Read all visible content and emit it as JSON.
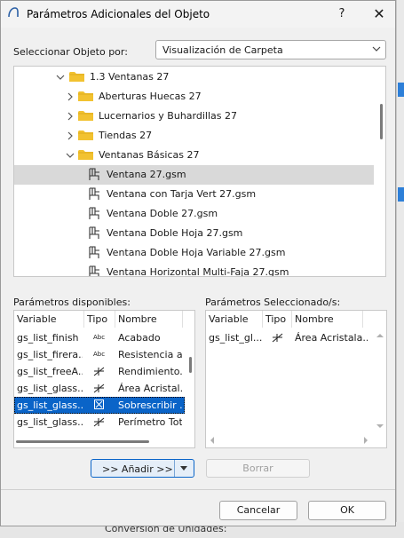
{
  "dialog": {
    "title": "Parámetros Adicionales del Objeto",
    "help_label": "?",
    "close_label": "✕"
  },
  "select_by": {
    "label": "Seleccionar Objeto por:",
    "value": "Visualización de Carpeta"
  },
  "tree": {
    "items": [
      {
        "label": "1.3 Ventanas 27",
        "kind": "folder",
        "expanded": true
      },
      {
        "label": "Aberturas Huecas 27",
        "kind": "folder",
        "expanded": false
      },
      {
        "label": "Lucernarios y Buhardillas 27",
        "kind": "folder",
        "expanded": false
      },
      {
        "label": "Tiendas 27",
        "kind": "folder",
        "expanded": false
      },
      {
        "label": "Ventanas Básicas 27",
        "kind": "folder",
        "expanded": true
      },
      {
        "label": "Ventana 27.gsm",
        "kind": "object",
        "selected": true
      },
      {
        "label": "Ventana con Tarja Vert 27.gsm",
        "kind": "object"
      },
      {
        "label": "Ventana Doble 27.gsm",
        "kind": "object"
      },
      {
        "label": "Ventana Doble Hoja 27.gsm",
        "kind": "object"
      },
      {
        "label": "Ventana Doble Hoja Variable 27.gsm",
        "kind": "object"
      },
      {
        "label": "Ventana Horizontal Multi-Faja 27.gsm",
        "kind": "object"
      }
    ]
  },
  "available": {
    "label": "Parámetros disponibles:",
    "columns": [
      "Variable",
      "Tipo",
      "Nombre"
    ],
    "rows": [
      {
        "variable": "gs_list_finish",
        "type": "Abc",
        "type_icon": "text-type-icon",
        "name": "Acabado"
      },
      {
        "variable": "gs_list_firera...",
        "type": "Abc",
        "type_icon": "text-type-icon",
        "name": "Resistencia a..."
      },
      {
        "variable": "gs_list_freeA...",
        "type": "",
        "type_icon": "area-type-icon",
        "name": "Rendimiento..."
      },
      {
        "variable": "gs_list_glass...",
        "type": "",
        "type_icon": "area-type-icon",
        "name": "Área Acristal..."
      },
      {
        "variable": "gs_list_glass...",
        "type": "",
        "type_icon": "checkbox-type-icon",
        "name": "Sobrescribir ...",
        "selected": true
      },
      {
        "variable": "gs_list_glass...",
        "type": "",
        "type_icon": "area-type-icon",
        "name": "Perímetro Tot..."
      }
    ]
  },
  "selected_params": {
    "label": "Parámetros Seleccionado/s:",
    "columns": [
      "Variable",
      "Tipo",
      "Nombre"
    ],
    "rows": [
      {
        "variable": "gs_list_gl...",
        "type": "",
        "type_icon": "area-type-icon",
        "name": "Área Acristala..."
      }
    ]
  },
  "buttons": {
    "add": ">> Añadir >>",
    "delete": "Borrar",
    "cancel": "Cancelar",
    "ok": "OK"
  },
  "background": {
    "bottom_text": "Conversión de Unidades:"
  },
  "colors": {
    "selection_blue": "#0a64c8",
    "folder_yellow": "#f2c230",
    "tree_selected": "#d9d9d9"
  }
}
